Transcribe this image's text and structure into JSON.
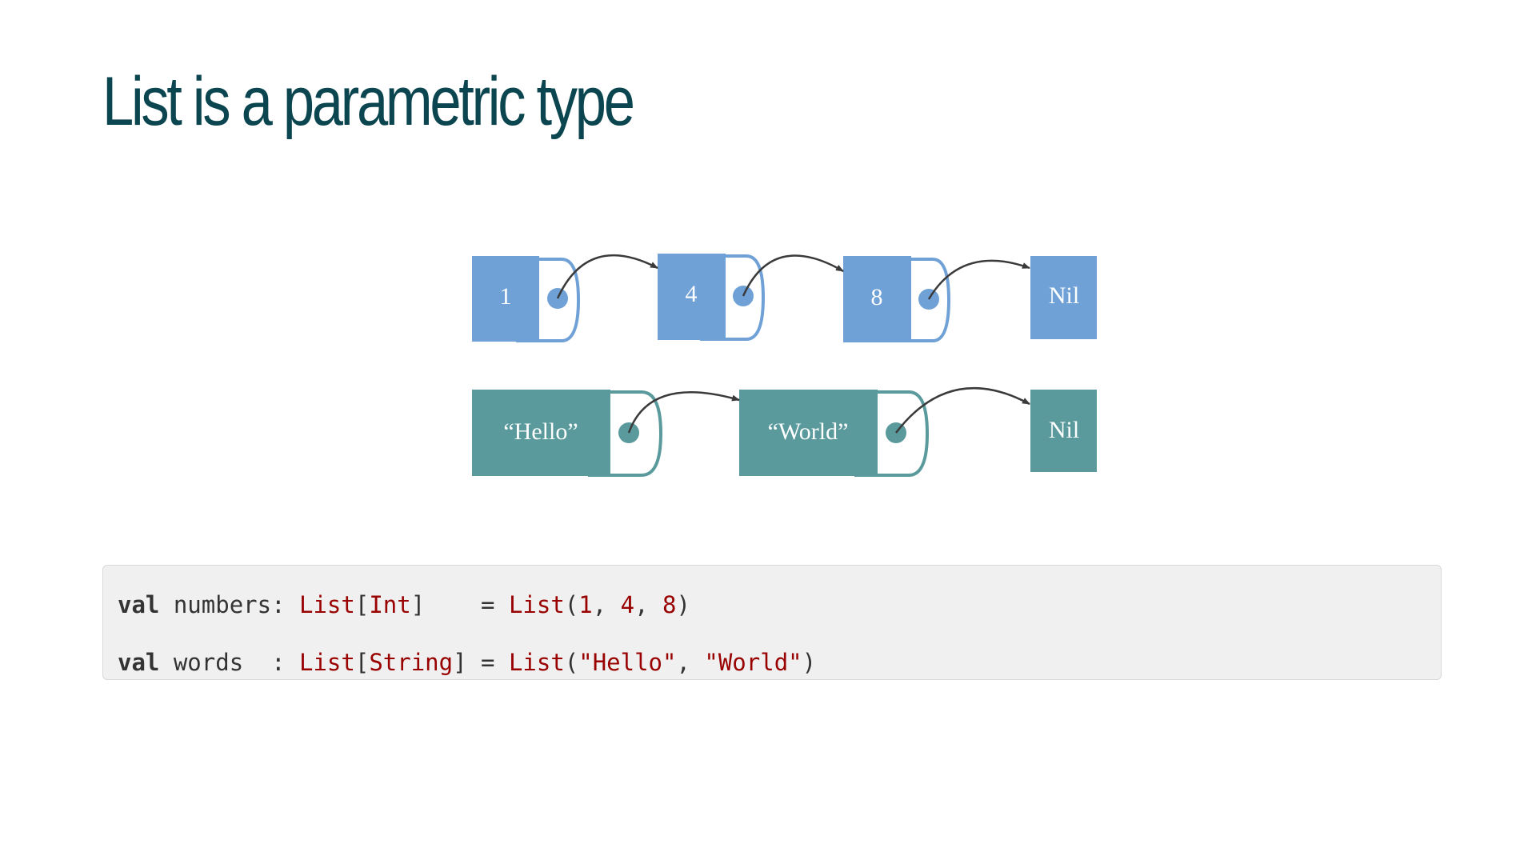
{
  "slide": {
    "title": "List is a parametric type"
  },
  "diagram": {
    "number_list": {
      "nodes": [
        "1",
        "4",
        "8"
      ],
      "terminal": "Nil"
    },
    "string_list": {
      "nodes": [
        "“Hello”",
        "“World”"
      ],
      "terminal": "Nil"
    },
    "colors": {
      "number_nodes": "#70a1d6",
      "string_nodes": "#5a9a9c",
      "arrows": "#3a3a3a",
      "title": "#0b4650"
    }
  },
  "code": {
    "line1": {
      "keyword": "val",
      "name": " numbers: ",
      "type_outer": "List",
      "open_bracket": "[",
      "type_param": "Int",
      "close_bracket": "]",
      "equals": "    = ",
      "ctor": "List",
      "open_paren": "(",
      "arg1": "1",
      "sep1": ", ",
      "arg2": "4",
      "sep2": ", ",
      "arg3": "8",
      "close_paren": ")"
    },
    "line2": {
      "keyword": "val",
      "name": " words  : ",
      "type_outer": "List",
      "open_bracket": "[",
      "type_param": "String",
      "close_bracket": "]",
      "equals": " = ",
      "ctor": "List",
      "open_paren": "(",
      "arg1": "\"Hello\"",
      "sep1": ", ",
      "arg2": "\"World\"",
      "close_paren": ")"
    }
  }
}
